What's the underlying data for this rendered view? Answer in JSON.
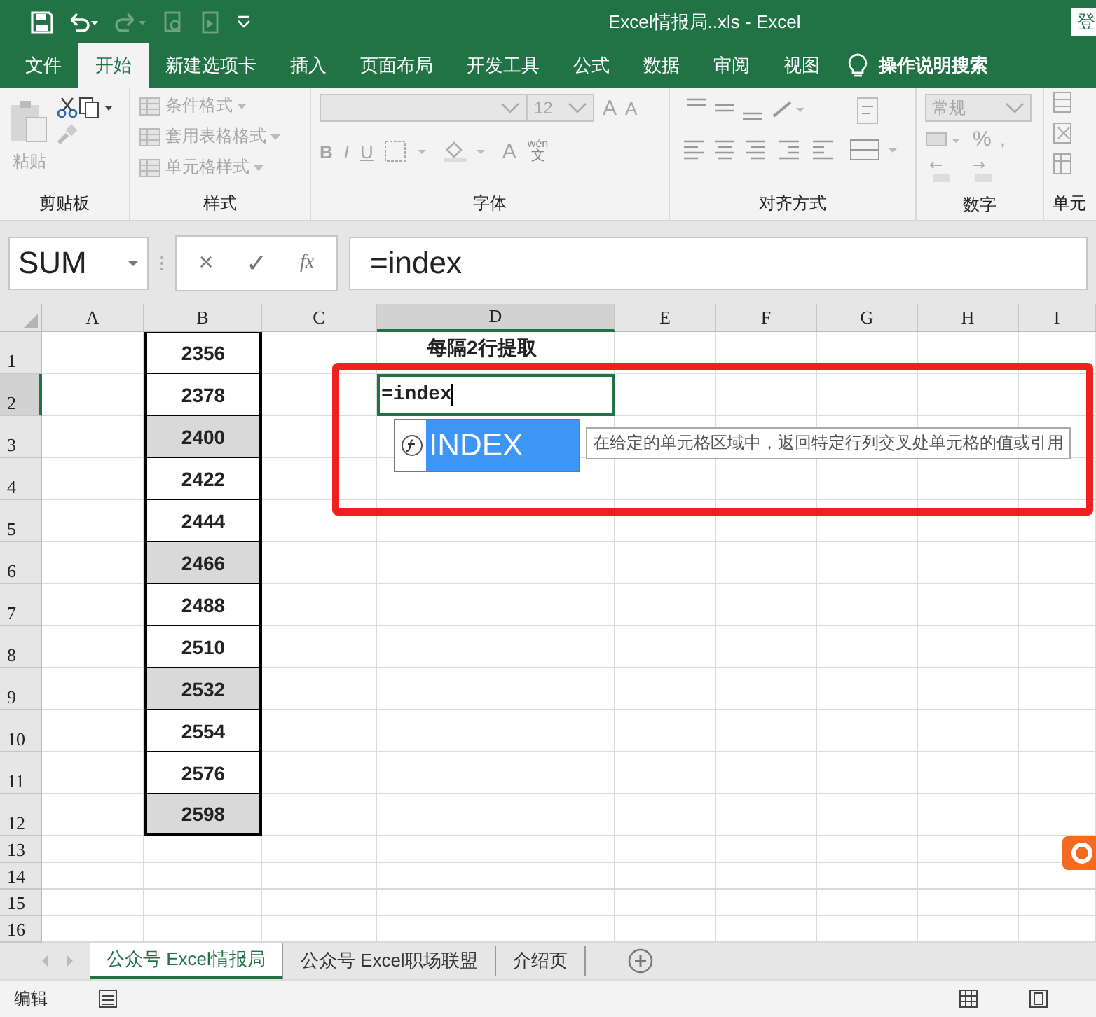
{
  "window": {
    "title": "Excel情报局..xls  -  Excel",
    "account_button": "登"
  },
  "menu_tabs": [
    {
      "label": "文件",
      "selected": false
    },
    {
      "label": "开始",
      "selected": true
    },
    {
      "label": "新建选项卡",
      "selected": false
    },
    {
      "label": "插入",
      "selected": false
    },
    {
      "label": "页面布局",
      "selected": false
    },
    {
      "label": "开发工具",
      "selected": false
    },
    {
      "label": "公式",
      "selected": false
    },
    {
      "label": "数据",
      "selected": false
    },
    {
      "label": "审阅",
      "selected": false
    },
    {
      "label": "视图",
      "selected": false
    }
  ],
  "tell_me": "操作说明搜索",
  "ribbon": {
    "clipboard": {
      "paste": "粘贴",
      "label": "剪贴板"
    },
    "styles": {
      "items": [
        "条件格式",
        "套用表格格式",
        "单元格样式"
      ],
      "label": "样式"
    },
    "font": {
      "size": "12",
      "grow": "A",
      "shrink": "A",
      "bold": "B",
      "italic": "I",
      "underline": "U",
      "font_color": "A",
      "phonetic_top": "wén",
      "phonetic_bottom": "文",
      "label": "字体"
    },
    "alignment": {
      "label": "对齐方式"
    },
    "number": {
      "format": "常规",
      "percent": "%",
      "comma": ",",
      "label": "数字"
    },
    "cells": {
      "label": "单元"
    }
  },
  "formula_bar": {
    "name_box": "SUM",
    "cancel": "×",
    "enter": "✓",
    "function": "fx",
    "value": "=index"
  },
  "columns": [
    "A",
    "B",
    "C",
    "D",
    "E",
    "F",
    "G",
    "H",
    "I"
  ],
  "rows": [
    {
      "number": "1",
      "b": "2356",
      "highlighted": false,
      "d": "每隔2行提取"
    },
    {
      "number": "2",
      "b": "2378",
      "highlighted": false,
      "d": "=index"
    },
    {
      "number": "3",
      "b": "2400",
      "highlighted": true
    },
    {
      "number": "4",
      "b": "2422",
      "highlighted": false
    },
    {
      "number": "5",
      "b": "2444",
      "highlighted": false
    },
    {
      "number": "6",
      "b": "2466",
      "highlighted": true
    },
    {
      "number": "7",
      "b": "2488",
      "highlighted": false
    },
    {
      "number": "8",
      "b": "2510",
      "highlighted": false
    },
    {
      "number": "9",
      "b": "2532",
      "highlighted": true
    },
    {
      "number": "10",
      "b": "2554",
      "highlighted": false
    },
    {
      "number": "11",
      "b": "2576",
      "highlighted": false
    },
    {
      "number": "12",
      "b": "2598",
      "highlighted": true
    },
    {
      "number": "13"
    },
    {
      "number": "14"
    },
    {
      "number": "15"
    },
    {
      "number": "16"
    }
  ],
  "autocomplete": {
    "suggestion": "INDEX",
    "tooltip": "在给定的单元格区域中，返回特定行列交叉处单元格的值或引用"
  },
  "sheet_tabs": [
    {
      "label": "公众号 Excel情报局",
      "selected": true
    },
    {
      "label": "公众号 Excel职场联盟",
      "selected": false
    },
    {
      "label": "介绍页",
      "selected": false
    }
  ],
  "status_bar": {
    "mode": "编辑"
  }
}
